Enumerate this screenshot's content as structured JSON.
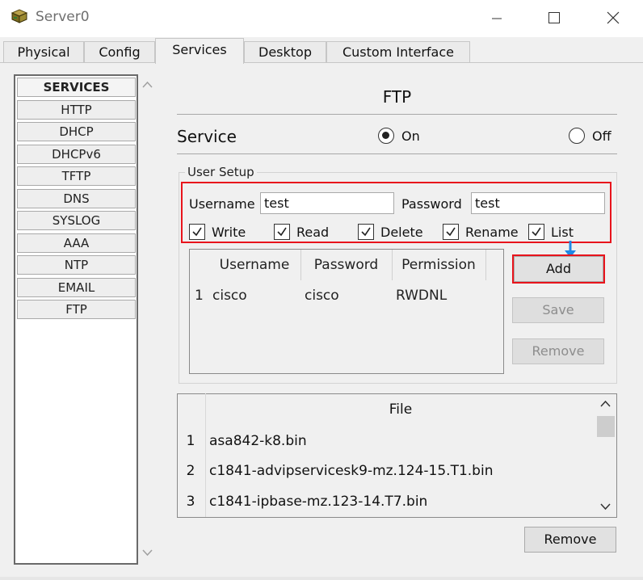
{
  "window": {
    "title": "Server0"
  },
  "tabs": [
    "Physical",
    "Config",
    "Services",
    "Desktop",
    "Custom Interface"
  ],
  "active_tab": "Services",
  "sidebar": {
    "header": "SERVICES",
    "items": [
      "HTTP",
      "DHCP",
      "DHCPv6",
      "TFTP",
      "DNS",
      "SYSLOG",
      "AAA",
      "NTP",
      "EMAIL",
      "FTP"
    ]
  },
  "ftp": {
    "title": "FTP",
    "service_label": "Service",
    "on_label": "On",
    "off_label": "Off",
    "selected": "On"
  },
  "user_setup": {
    "legend": "User Setup",
    "username_label": "Username",
    "username_value": "test",
    "password_label": "Password",
    "password_value": "test",
    "permissions": [
      {
        "label": "Write",
        "checked": true
      },
      {
        "label": "Read",
        "checked": true
      },
      {
        "label": "Delete",
        "checked": true
      },
      {
        "label": "Rename",
        "checked": true
      },
      {
        "label": "List",
        "checked": true
      }
    ]
  },
  "users_table": {
    "columns": [
      "Username",
      "Password",
      "Permission"
    ],
    "rows": [
      {
        "index": "1",
        "username": "cisco",
        "password": "cisco",
        "permission": "RWDNL"
      }
    ]
  },
  "buttons": {
    "add": "Add",
    "save": "Save",
    "remove_user": "Remove",
    "remove_file": "Remove"
  },
  "files": {
    "header": "File",
    "rows": [
      {
        "index": "1",
        "name": "asa842-k8.bin"
      },
      {
        "index": "2",
        "name": "c1841-advipservicesk9-mz.124-15.T1.bin"
      },
      {
        "index": "3",
        "name": "c1841-ipbase-mz.123-14.T7.bin"
      }
    ]
  },
  "colors": {
    "highlight": "#e8141c",
    "arrow": "#1e88e5"
  }
}
